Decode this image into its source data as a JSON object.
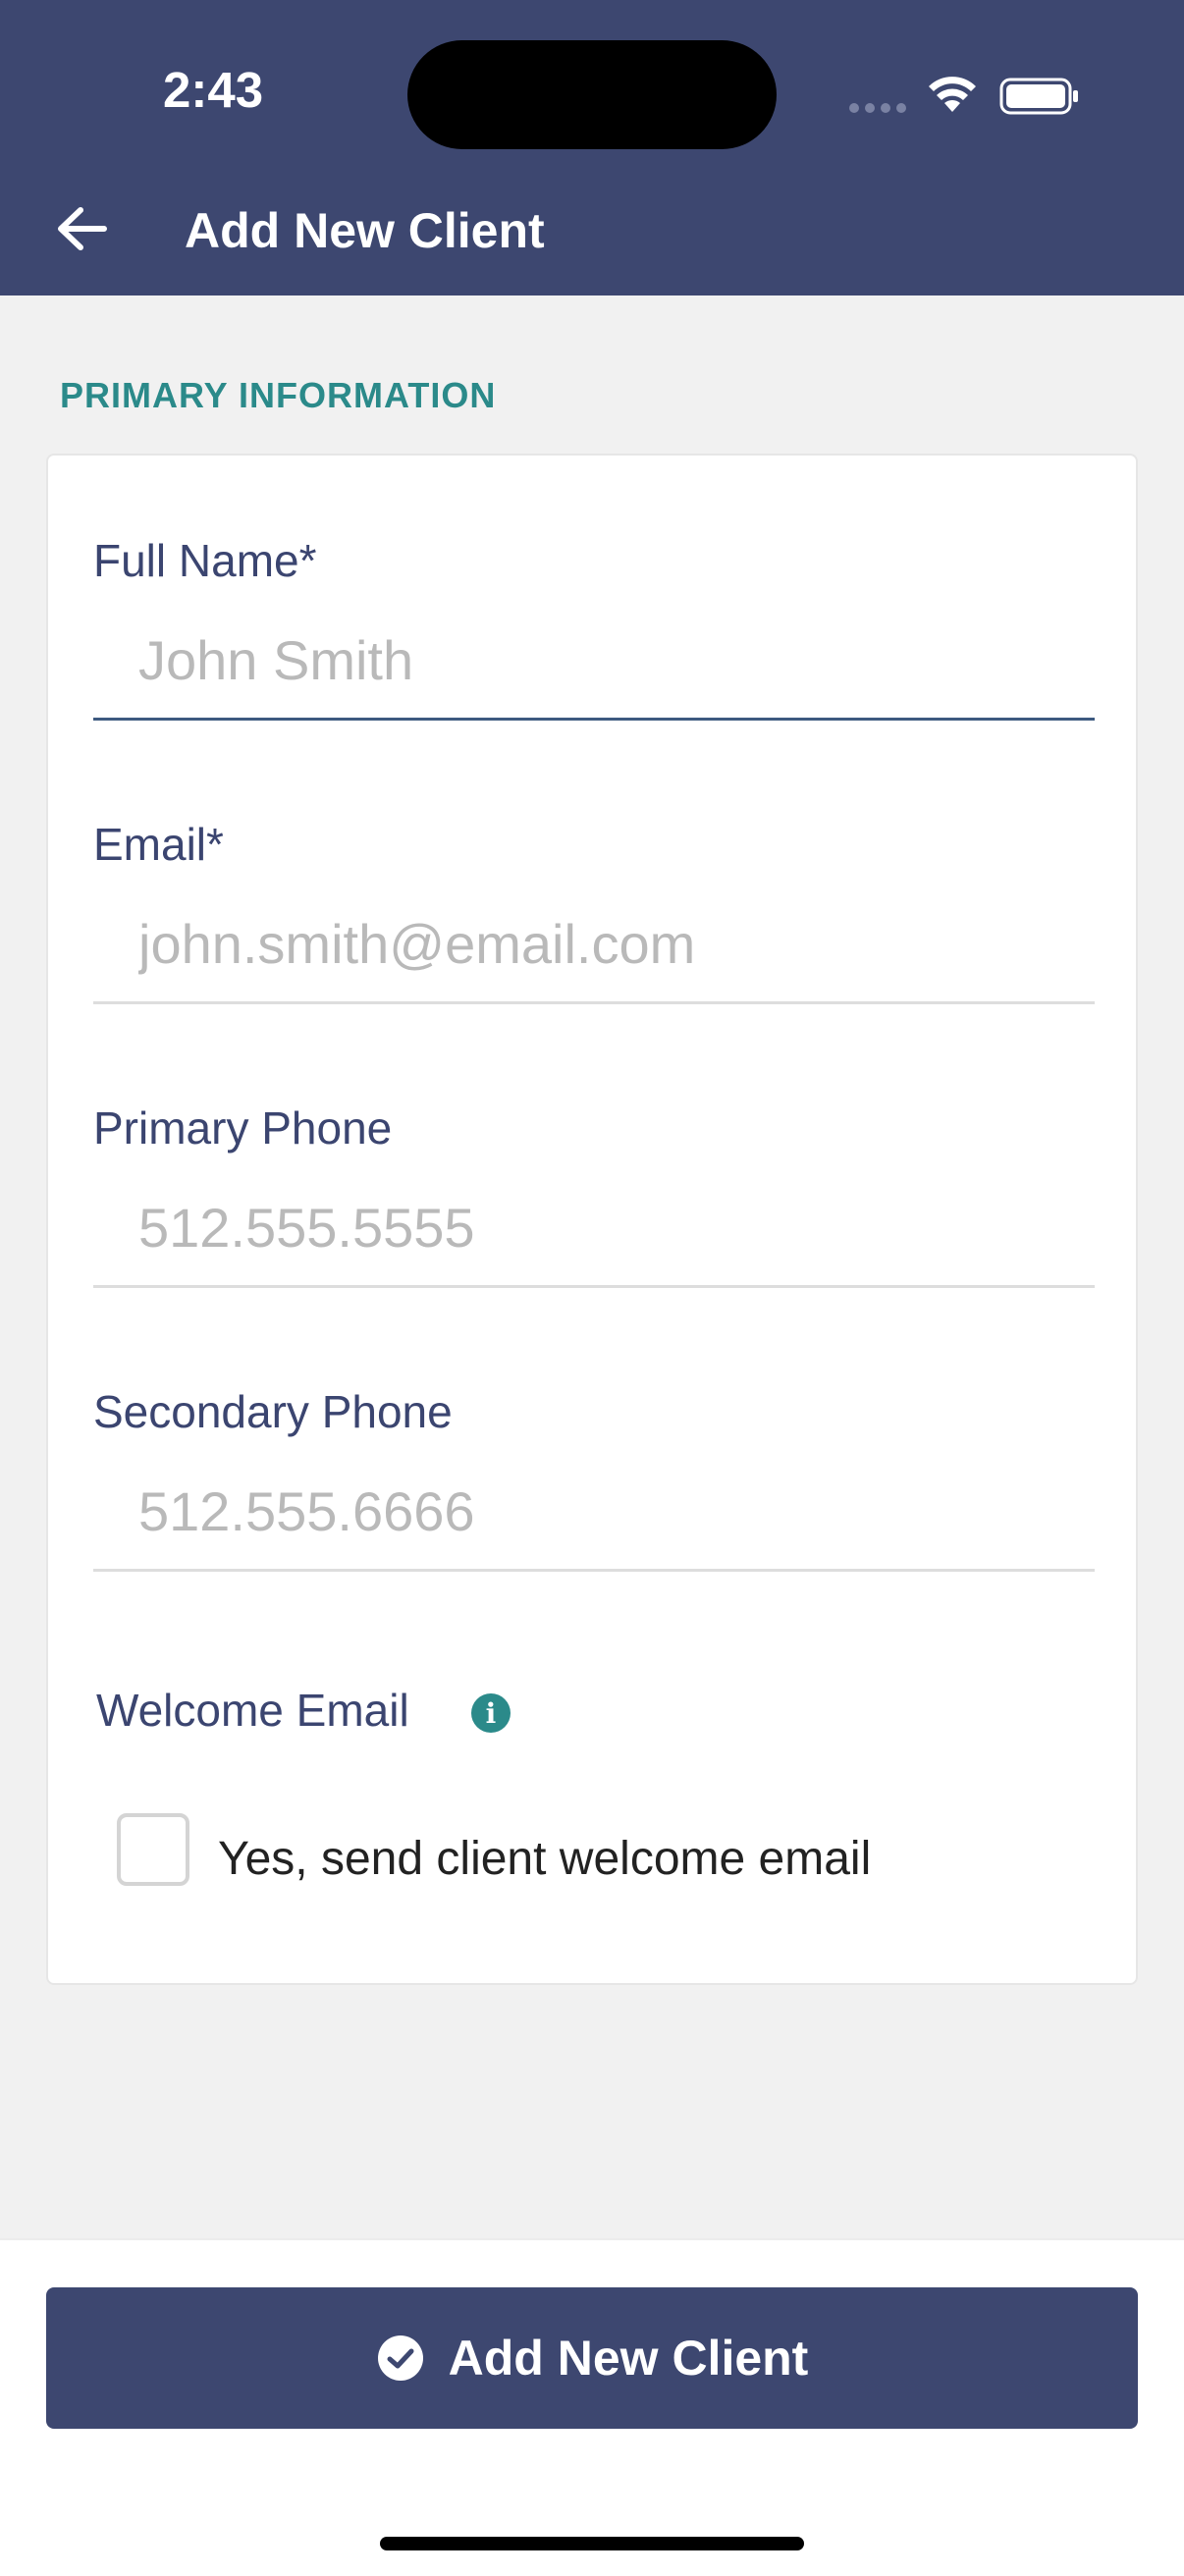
{
  "status_bar": {
    "time": "2:43"
  },
  "header": {
    "title": "Add New Client"
  },
  "section": {
    "label": "PRIMARY INFORMATION"
  },
  "form": {
    "full_name": {
      "label": "Full Name*",
      "placeholder": "John Smith",
      "value": ""
    },
    "email": {
      "label": "Email*",
      "placeholder": "john.smith@email.com",
      "value": ""
    },
    "primary_phone": {
      "label": "Primary Phone",
      "placeholder": "512.555.5555",
      "value": ""
    },
    "secondary_phone": {
      "label": "Secondary Phone",
      "placeholder": "512.555.6666",
      "value": ""
    },
    "welcome_email": {
      "label": "Welcome Email",
      "info_icon": "info-icon",
      "checkbox_label": "Yes, send client welcome email",
      "checked": false
    }
  },
  "footer": {
    "button_label": "Add New Client",
    "button_icon": "check-circle-icon"
  },
  "colors": {
    "header_bg": "#3d4770",
    "accent_teal": "#2b8a8a",
    "label_text": "#3b4570",
    "placeholder_text": "#b9b9b9",
    "focused_underline": "#3d5a80"
  }
}
